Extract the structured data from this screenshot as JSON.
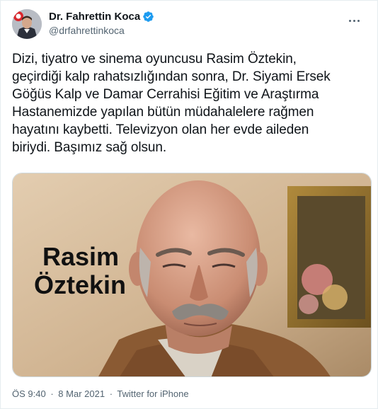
{
  "author": {
    "display_name": "Dr. Fahrettin Koca",
    "handle": "@drfahrettinkoca",
    "verified": true
  },
  "tweet": {
    "text_lines": [
      "Dizi, tiyatro ve sinema oyuncusu Rasim Öztekin,",
      "geçirdiği kalp rahatsızlığından sonra, Dr. Siyami Ersek",
      "Göğüs Kalp ve Damar Cerrahisi Eğitim ve Araştırma",
      "Hastanemizde yapılan bütün müdahalelere rağmen",
      "hayatını kaybetti. Televizyon olan her evde aileden",
      "biriydi. Başımız sağ olsun."
    ],
    "image_caption_line1": "Rasim",
    "image_caption_line2": "Öztekin"
  },
  "meta": {
    "time": "ÖS 9:40",
    "date": "8 Mar 2021",
    "source": "Twitter for iPhone",
    "separator": "·"
  },
  "colors": {
    "verified_blue": "#1d9bf0",
    "secondary_text": "#536471",
    "primary_text": "#0f1419"
  },
  "icons": {
    "verified": "verified-badge-icon",
    "more": "more-dots-icon"
  }
}
